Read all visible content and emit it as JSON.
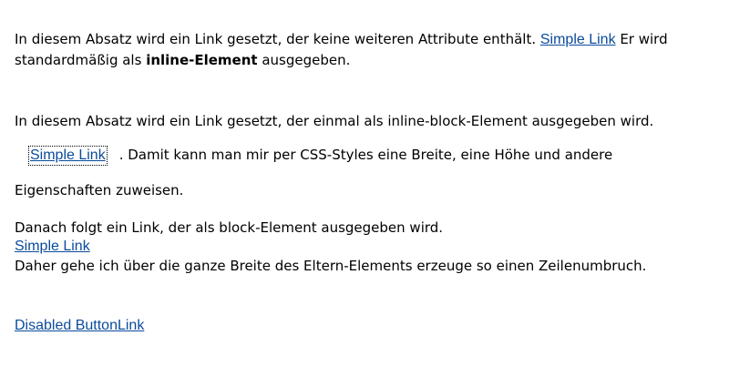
{
  "p1": {
    "text_before": "In diesem Absatz wird ein Link gesetzt, der keine weiteren Attribute enthält. ",
    "link": "Simple Link",
    "text_mid": " Er wird standardmäßig als ",
    "bold": "inline-Element",
    "text_after": " ausgegeben."
  },
  "p2": {
    "text_before": "In diesem Absatz wird ein Link gesetzt, der einmal als inline-block-Element ausgegeben wird.",
    "link": "Simple Link",
    "text_mid": ". Damit kann man mir per CSS-Styles eine Breite, eine Höhe und andere",
    "text_after": "Eigenschaften zuweisen."
  },
  "p3": {
    "text_before": "Danach folgt ein Link, der als block-Element ausgegeben wird.",
    "link": "Simple Link",
    "text_after": "Daher gehe ich über die ganze Breite des Eltern-Elements erzeuge so einen Zeilenumbruch."
  },
  "p4": {
    "link": "Disabled ButtonLink"
  }
}
